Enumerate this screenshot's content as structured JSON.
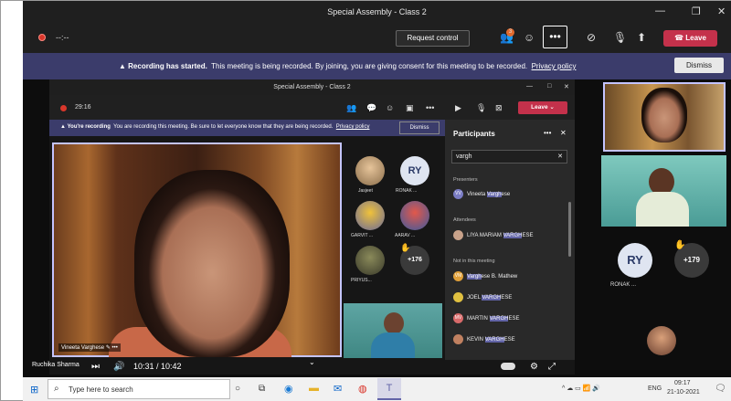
{
  "window": {
    "title": "Special Assembly - Class 2",
    "minimize": "—",
    "restore": "❐",
    "close": "✕"
  },
  "toolbar": {
    "timer": "--:--",
    "request_control": "Request control",
    "participants_badge": "3",
    "more": "•••",
    "leave": "Leave"
  },
  "banner": {
    "bold": "Recording has started.",
    "text": "This meeting is being recorded. By joining, you are giving consent for this meeting to be recorded.",
    "link": "Privacy policy",
    "dismiss": "Dismiss"
  },
  "inner": {
    "title": "Special Assembly - Class 2",
    "timer": "29:16",
    "leave": "Leave",
    "banner_bold": "You're recording",
    "banner_text": "You are recording this meeting. Be sure to let everyone know that they are being recorded.",
    "banner_link": "Privacy policy",
    "dismiss": "Dismiss",
    "video_name": "Vineeta Varghese",
    "grid": [
      {
        "label": "Jasjeet",
        "initials": ""
      },
      {
        "label": "RONAK ...",
        "initials": "RY"
      },
      {
        "label": "GARVIT ...",
        "initials": ""
      },
      {
        "label": "AARAV ...",
        "initials": ""
      },
      {
        "label": "PRIYUS...",
        "initials": ""
      },
      {
        "label": "",
        "initials": "+176"
      }
    ]
  },
  "panel": {
    "title": "Participants",
    "search": "vargh",
    "presenters_label": "Presenters",
    "attendees_label": "Attendees",
    "not_in_label": "Not in this meeting",
    "presenters": [
      {
        "pre": "Vineeta ",
        "hl": "Vargh",
        "post": "ese",
        "initials": "VV",
        "color": "#7a7cc4"
      }
    ],
    "attendees": [
      {
        "pre": "LIYA MARIAM ",
        "hl": "VARGH",
        "post": "ESE",
        "initials": "",
        "color": "#c8a28a"
      }
    ],
    "not_in": [
      {
        "pre": "",
        "hl": "Vargh",
        "post": "ese B. Mathew",
        "initials": "VM",
        "color": "#e0a03a"
      },
      {
        "pre": "JOEL ",
        "hl": "VARGH",
        "post": "ESE",
        "initials": "",
        "color": "#e0c040"
      },
      {
        "pre": "MARTIN ",
        "hl": "VARGH",
        "post": "ESE",
        "initials": "MV",
        "color": "#d86a6a"
      },
      {
        "pre": "KEVIN ",
        "hl": "VARGH",
        "post": "ESE",
        "initials": "",
        "color": "#c08060"
      }
    ]
  },
  "right": {
    "ry_initials": "RY",
    "ry_label": "RONAK ...",
    "plus_count": "+179"
  },
  "player": {
    "presenter": "Ruchika Sharma",
    "time": "10:31 / 10:42"
  },
  "taskbar": {
    "search_placeholder": "Type here to search",
    "lang": "ENG",
    "time": "09:17",
    "date": "21-10-2021"
  }
}
